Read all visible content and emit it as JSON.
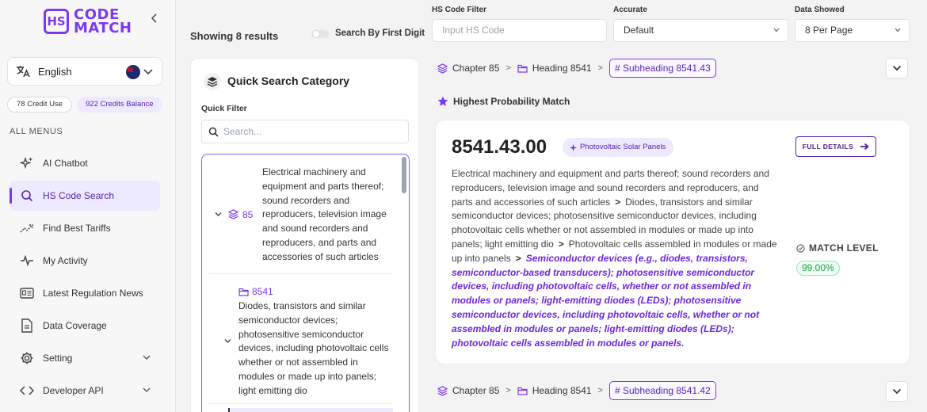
{
  "logo": {
    "mark": "HS",
    "line1": "CODE",
    "line2": "MATCH"
  },
  "language": {
    "label": "English"
  },
  "credits": {
    "used": "78 Credit Use",
    "balance": "922 Credits Balance"
  },
  "menu_heading": "ALL MENUS",
  "nav": [
    {
      "label": "AI Chatbot",
      "icon": "sparkle-icon"
    },
    {
      "label": "HS Code Search",
      "icon": "search-icon",
      "active": true
    },
    {
      "label": "Find Best Tariffs",
      "icon": "trend-icon"
    },
    {
      "label": "My Activity",
      "icon": "pulse-icon"
    },
    {
      "label": "Latest Regulation News",
      "icon": "news-icon"
    },
    {
      "label": "Data Coverage",
      "icon": "document-icon"
    },
    {
      "label": "Setting",
      "icon": "gear-icon"
    },
    {
      "label": "Developer API",
      "icon": "code-icon"
    }
  ],
  "topbar": {
    "showing": "Showing 8 results",
    "toggle_label": "Search By First Digit",
    "filter_label": "HS Code Filter",
    "filter_placeholder": "Input HS Code",
    "accurate_label": "Accurate",
    "accurate_value": "Default",
    "data_label": "Data Showed",
    "data_value": "8 Per Page"
  },
  "quick": {
    "title": "Quick Search Category",
    "filter_label": "Quick Filter",
    "search_placeholder": "Search...",
    "chapter_num": "85",
    "chapter_text": "Electrical machinery and equipment and parts thereof; sound recorders and reproducers, television image and sound recorders and reproducers, and parts and accessories of such articles",
    "heading_num": "8541",
    "heading_text": "Diodes, transistors and similar semiconductor devices; photosensitive semiconductor devices, including photovoltaic cells whether or not assembled in modules or made up into panels; light emitting dio"
  },
  "results": [
    {
      "chapter": "Chapter 85",
      "heading": "Heading 8541",
      "subheading": "# Subheading 8541.43"
    },
    {
      "chapter": "Chapter 85",
      "heading": "Heading 8541",
      "subheading": "# Subheading 8541.42"
    }
  ],
  "highest": "Highest Probability Match",
  "card": {
    "code": "8541.43.00",
    "tag": "Photovoltaic Solar Panels",
    "full_details": "FULL DETAILS",
    "desc1": "Electrical machinery and equipment and parts thereof; sound recorders and reproducers, television image and sound recorders and reproducers, and parts and accessories of such articles",
    "desc2": "Diodes, transistors and similar semiconductor devices; photosensitive semiconductor devices, including photovoltaic cells whether or not assembled in modules or made up into panels; light emitting dio",
    "desc3": "Photovoltaic cells assembled in modules or made up into panels",
    "desc4": "Semiconductor devices (e.g., diodes, transistors, semiconductor-based transducers); photosensitive semiconductor devices, including photovoltaic cells, whether or not assembled in modules or panels; light-emitting diodes (LEDs); photosensitive semiconductor devices, including photovoltaic cells, whether or not assembled in modules or panels; light-emitting diodes (LEDs); photovoltaic cells assembled in modules or panels.",
    "match_label": "MATCH LEVEL",
    "match_value": "99.00%"
  },
  "colors": {
    "accent": "#7c3aed",
    "accent_bg": "#ede9fe",
    "match": "#16a34a"
  }
}
